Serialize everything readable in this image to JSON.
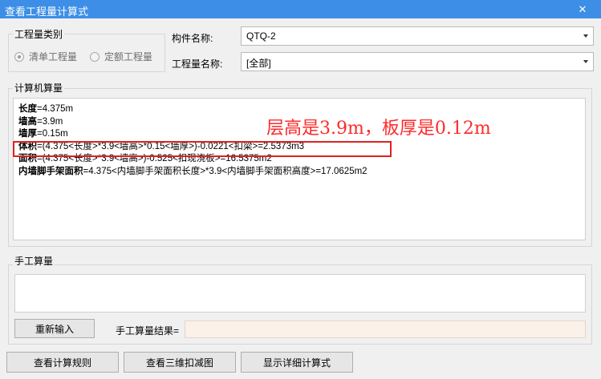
{
  "window": {
    "title": "查看工程量计算式",
    "close_glyph": "✕"
  },
  "category_group": {
    "title": "工程量类别",
    "options": [
      {
        "label": "清单工程量",
        "checked": true
      },
      {
        "label": "定额工程量",
        "checked": false
      }
    ]
  },
  "component": {
    "label": "构件名称:",
    "value": "QTQ-2"
  },
  "quantity_name": {
    "label": "工程量名称:",
    "value": "[全部]"
  },
  "calc_group": {
    "title": "计算机算量",
    "lines": [
      {
        "name": "长度",
        "expr": "=4.375m"
      },
      {
        "name": "墙高",
        "expr": "=3.9m"
      },
      {
        "name": "墙厚",
        "expr": "=0.15m"
      },
      {
        "name": "体积",
        "expr": "=(4.375<长度>*3.9<墙高>*0.15<墙厚>)-0.0221<扣梁>=2.5373m3"
      },
      {
        "name": "面积",
        "expr": "=(4.375<长度>*3.9<墙高>)-0.525<扣现浇板>=16.5375m2"
      },
      {
        "name": "内墙脚手架面积",
        "expr": "=4.375<内墙脚手架面积长度>*3.9<内墙脚手架面积高度>=17.0625m2"
      }
    ],
    "annotation": "层高是3.9m，板厚是0.12m",
    "annotation_color": "#ff2a2a"
  },
  "manual_group": {
    "title": "手工算量",
    "reenter_label": "重新输入",
    "result_label": "手工算量结果="
  },
  "footer": {
    "rules_label": "查看计算规则",
    "view3d_label": "查看三维扣减图",
    "detail_label": "显示详细计算式"
  }
}
